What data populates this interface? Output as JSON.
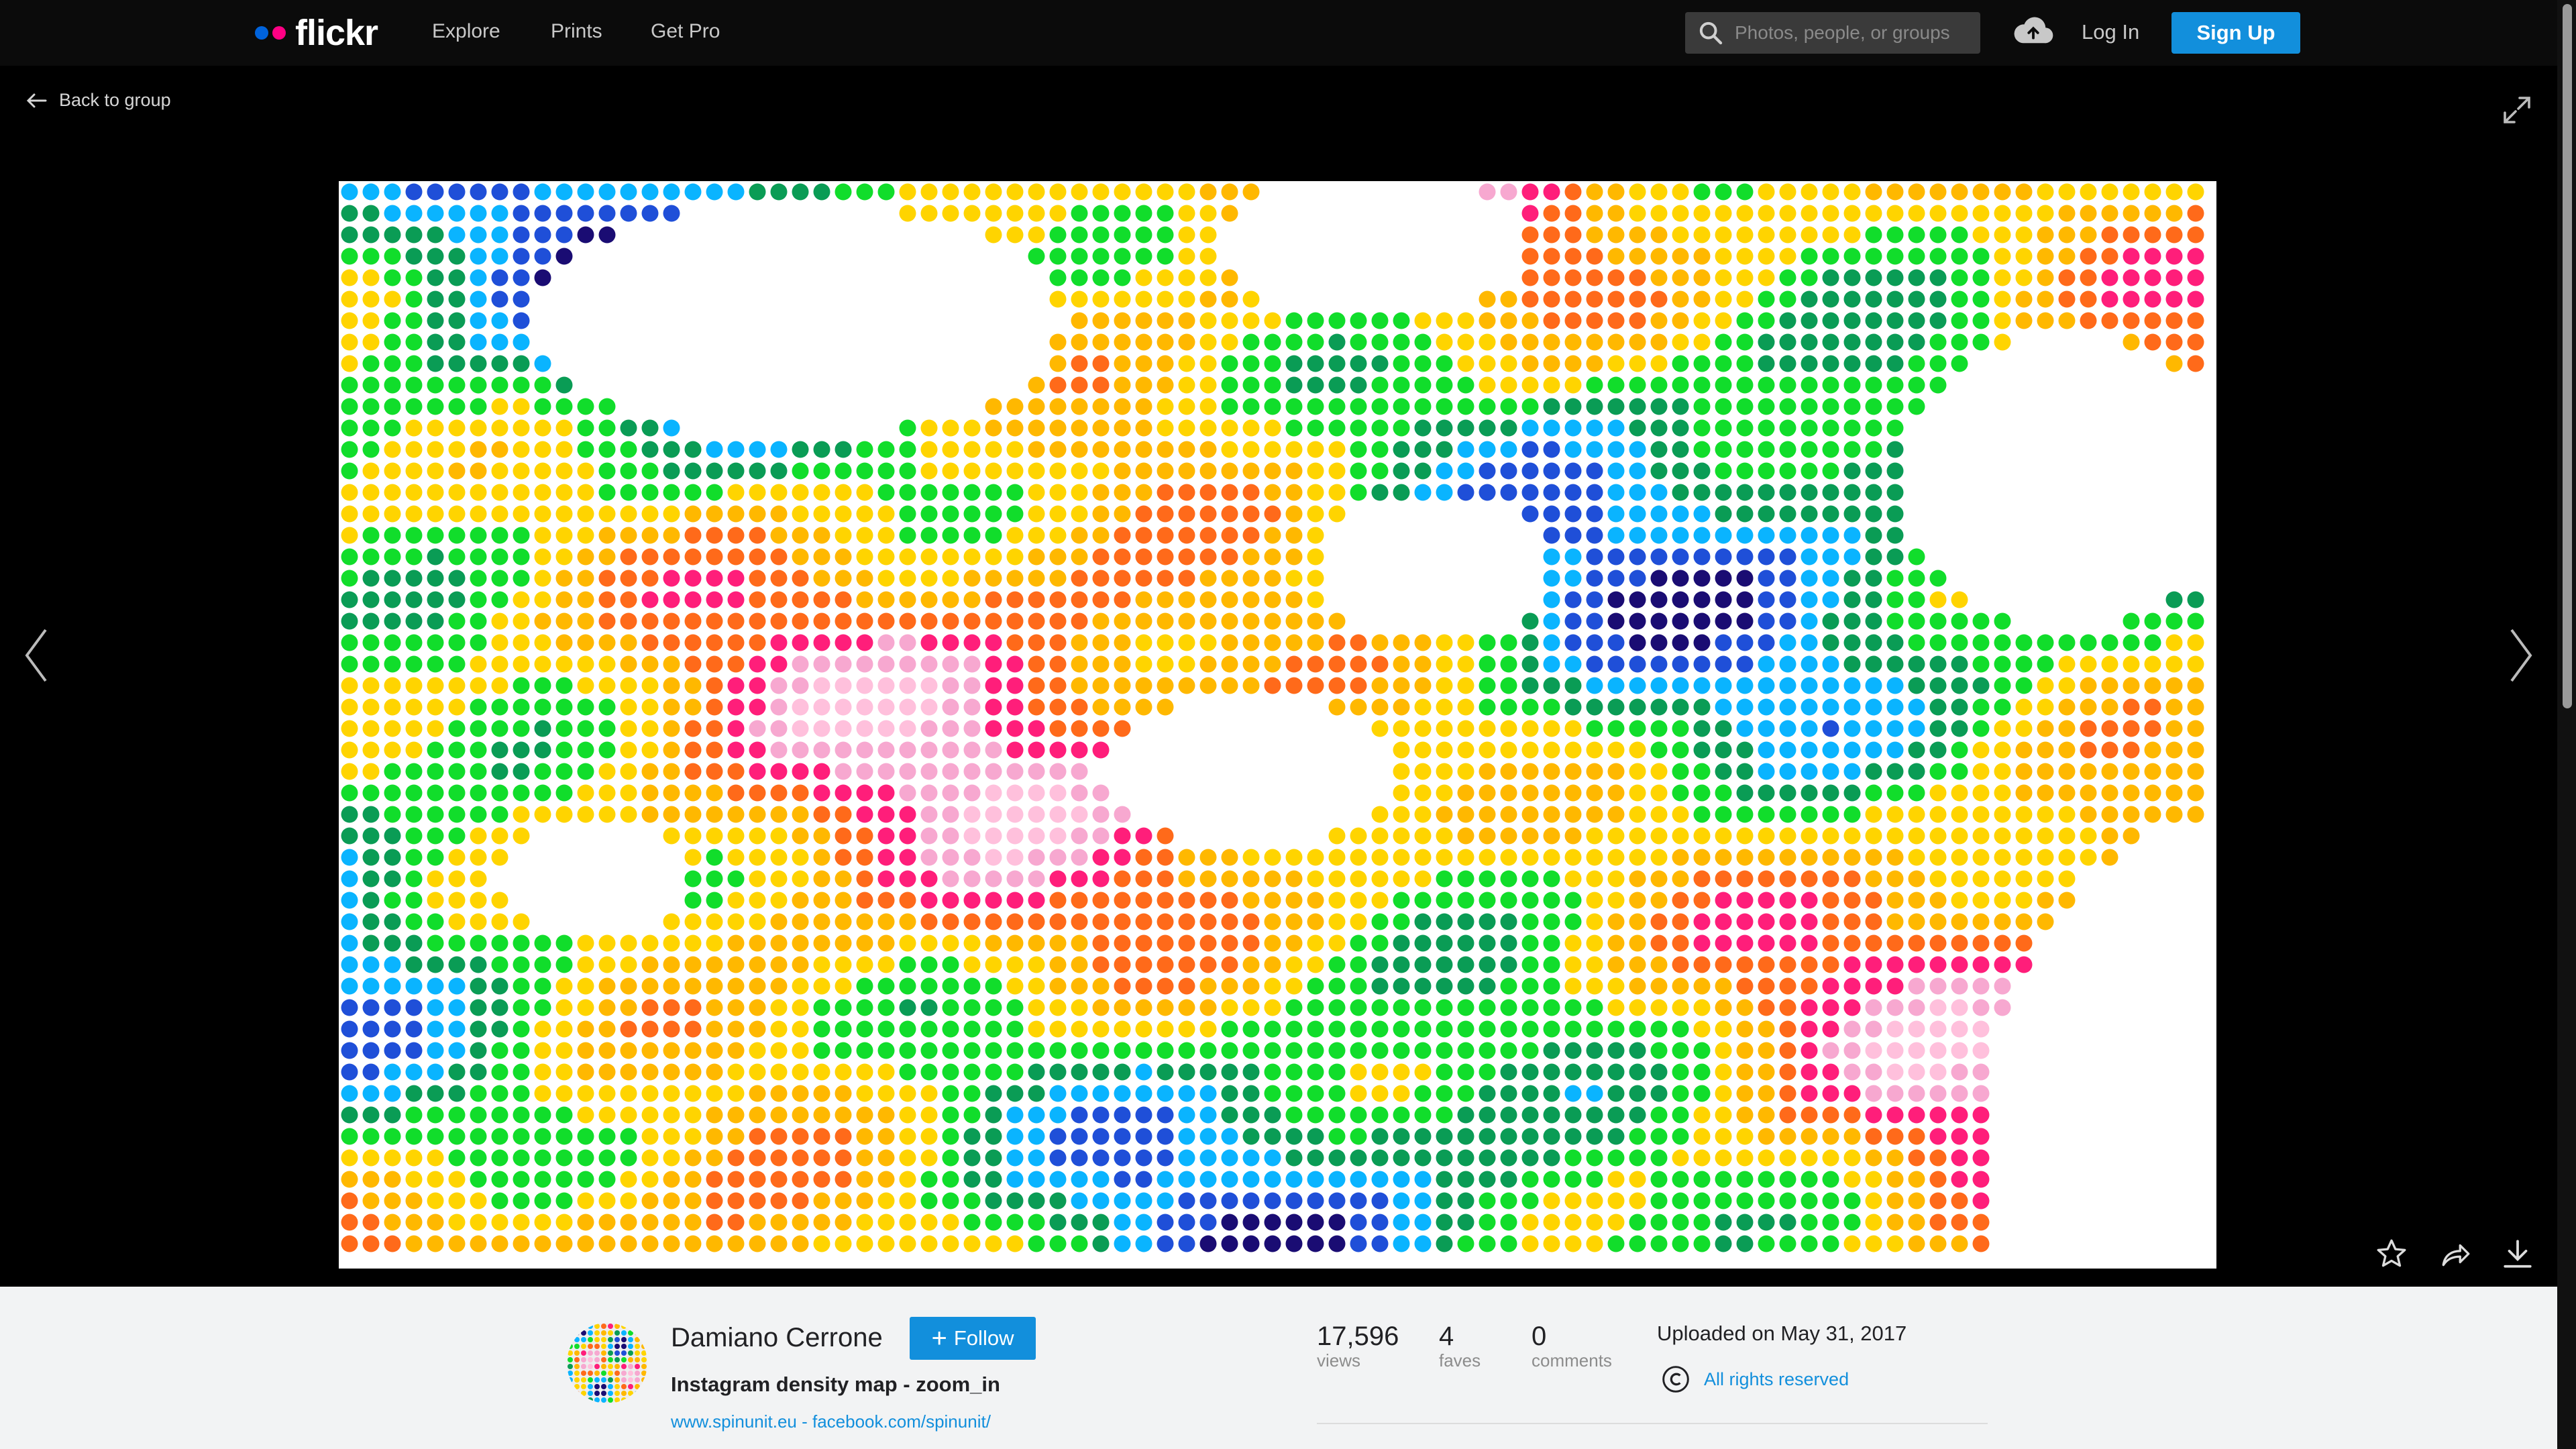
{
  "header": {
    "logo_text": "flickr",
    "logo_dot_colors": [
      "#0063dc",
      "#ff0084"
    ],
    "nav": [
      "Explore",
      "Prints",
      "Get Pro"
    ],
    "search_placeholder": "Photos, people, or groups",
    "login_label": "Log In",
    "signup_label": "Sign Up"
  },
  "viewer": {
    "back_label": "Back to group",
    "photo_description": "Instagram density map dot grid (zoom_in)",
    "dot_palette": [
      "#ffc0dc",
      "#f7a8d0",
      "#ff1e7a",
      "#ff6a1a",
      "#ffb800",
      "#ffd400",
      "#11dd2b",
      "#0a9c55",
      "#0ab4ff",
      "#1f4fd8",
      "#1a0c73"
    ],
    "accent_color": "#128fdc"
  },
  "photo_info": {
    "author": "Damiano Cerrone",
    "follow_label": "Follow",
    "title": "Instagram density map - zoom_in",
    "links": "www.spinunit.eu - facebook.com/spinunit/",
    "stats": [
      {
        "value": "17,596",
        "label": "views"
      },
      {
        "value": "4",
        "label": "faves"
      },
      {
        "value": "0",
        "label": "comments"
      }
    ],
    "uploaded": "Uploaded on May 31, 2017",
    "license": "All rights reserved"
  }
}
